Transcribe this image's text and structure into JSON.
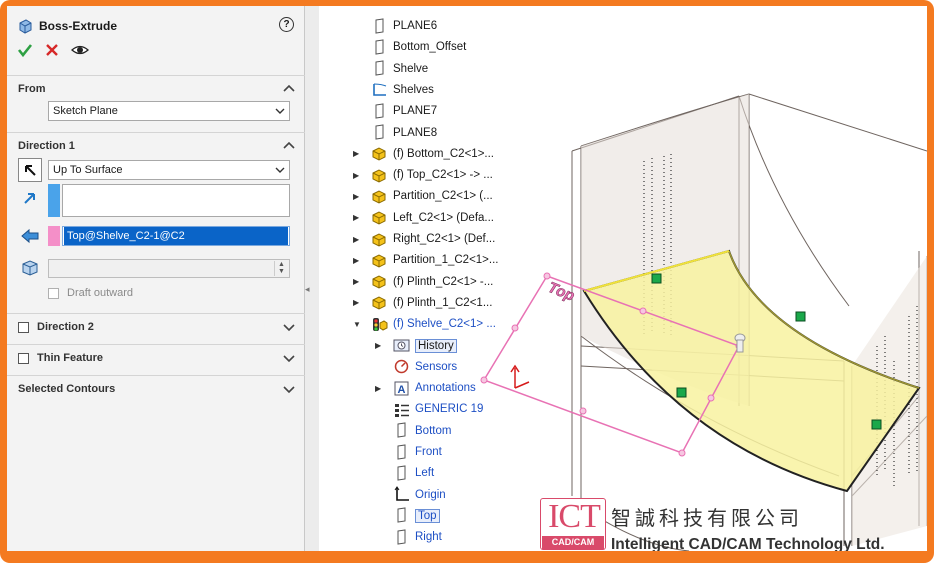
{
  "property_manager": {
    "title": "Boss-Extrude",
    "help_label": "?",
    "from": {
      "header": "From",
      "value": "Sketch Plane"
    },
    "direction1": {
      "header": "Direction 1",
      "end_condition": "Up To Surface",
      "face_selection": "Top@Shelve_C2-1@C2",
      "draft_outward_label": "Draft outward"
    },
    "direction2": {
      "header": "Direction 2"
    },
    "thin_feature": {
      "header": "Thin Feature"
    },
    "selected_contours": {
      "header": "Selected Contours"
    }
  },
  "tree": [
    {
      "label": "PLANE6",
      "icon": "plane-icon",
      "expand": "",
      "blue": false
    },
    {
      "label": "Bottom_Offset",
      "icon": "plane-icon",
      "expand": "",
      "blue": false
    },
    {
      "label": "Shelve",
      "icon": "plane-icon",
      "expand": "",
      "blue": false
    },
    {
      "label": "Shelves",
      "icon": "sketch-icon",
      "expand": "",
      "blue": false
    },
    {
      "label": "PLANE7",
      "icon": "plane-icon",
      "expand": "",
      "blue": false
    },
    {
      "label": "PLANE8",
      "icon": "plane-icon",
      "expand": "",
      "blue": false
    },
    {
      "label": "(f) Bottom_C2<1>...",
      "icon": "part-icon",
      "expand": "▶",
      "blue": false
    },
    {
      "label": "(f) Top_C2<1> -> ...",
      "icon": "part-icon",
      "expand": "▶",
      "blue": false
    },
    {
      "label": "Partition_C2<1> (...",
      "icon": "part-icon",
      "expand": "▶",
      "blue": false
    },
    {
      "label": "Left_C2<1> (Defa...",
      "icon": "part-icon",
      "expand": "▶",
      "blue": false
    },
    {
      "label": "Right_C2<1> (Def...",
      "icon": "part-icon",
      "expand": "▶",
      "blue": false
    },
    {
      "label": "Partition_1_C2<1>...",
      "icon": "part-icon",
      "expand": "▶",
      "blue": false
    },
    {
      "label": "(f) Plinth_C2<1> -...",
      "icon": "part-icon",
      "expand": "▶",
      "blue": false
    },
    {
      "label": "(f) Plinth_1_C2<1...",
      "icon": "part-icon",
      "expand": "▶",
      "blue": false
    },
    {
      "label": "(f) Shelve_C2<1> ...",
      "icon": "part-edit-icon",
      "expand": "▼",
      "blue": true
    },
    {
      "label": "History",
      "icon": "history-icon",
      "expand": "▶",
      "blue": false,
      "boxed": true,
      "indent": 1
    },
    {
      "label": "Sensors",
      "icon": "sensor-icon",
      "expand": "",
      "blue": true,
      "indent": 1
    },
    {
      "label": "Annotations",
      "icon": "annotation-icon",
      "expand": "▶",
      "blue": true,
      "indent": 1
    },
    {
      "label": "GENERIC 19",
      "icon": "material-icon",
      "expand": "",
      "blue": true,
      "indent": 1
    },
    {
      "label": "Bottom",
      "icon": "plane-icon",
      "expand": "",
      "blue": true,
      "indent": 1
    },
    {
      "label": "Front",
      "icon": "plane-icon",
      "expand": "",
      "blue": true,
      "indent": 1
    },
    {
      "label": "Left",
      "icon": "plane-icon",
      "expand": "",
      "blue": true,
      "indent": 1
    },
    {
      "label": "Origin",
      "icon": "origin-icon",
      "expand": "",
      "blue": true,
      "indent": 1
    },
    {
      "label": "Top",
      "icon": "plane-icon",
      "expand": "",
      "blue": true,
      "boxed": true,
      "indent": 1
    },
    {
      "label": "Right",
      "icon": "plane-icon",
      "expand": "",
      "blue": true,
      "indent": 1
    }
  ],
  "viewport": {
    "plane_label": "Top"
  },
  "logo": {
    "abbr": "ICT",
    "tag": "CAD/CAM",
    "chinese": "智誠科技有限公司",
    "english": "Intelligent CAD/CAM Technology Ltd."
  },
  "colors": {
    "frame": "#f47a20",
    "selection": "#0a64c8",
    "tree_blue": "#1d4fc4",
    "sketch_pink": "#e872b4",
    "face_yellow": "#f8f2a0"
  }
}
